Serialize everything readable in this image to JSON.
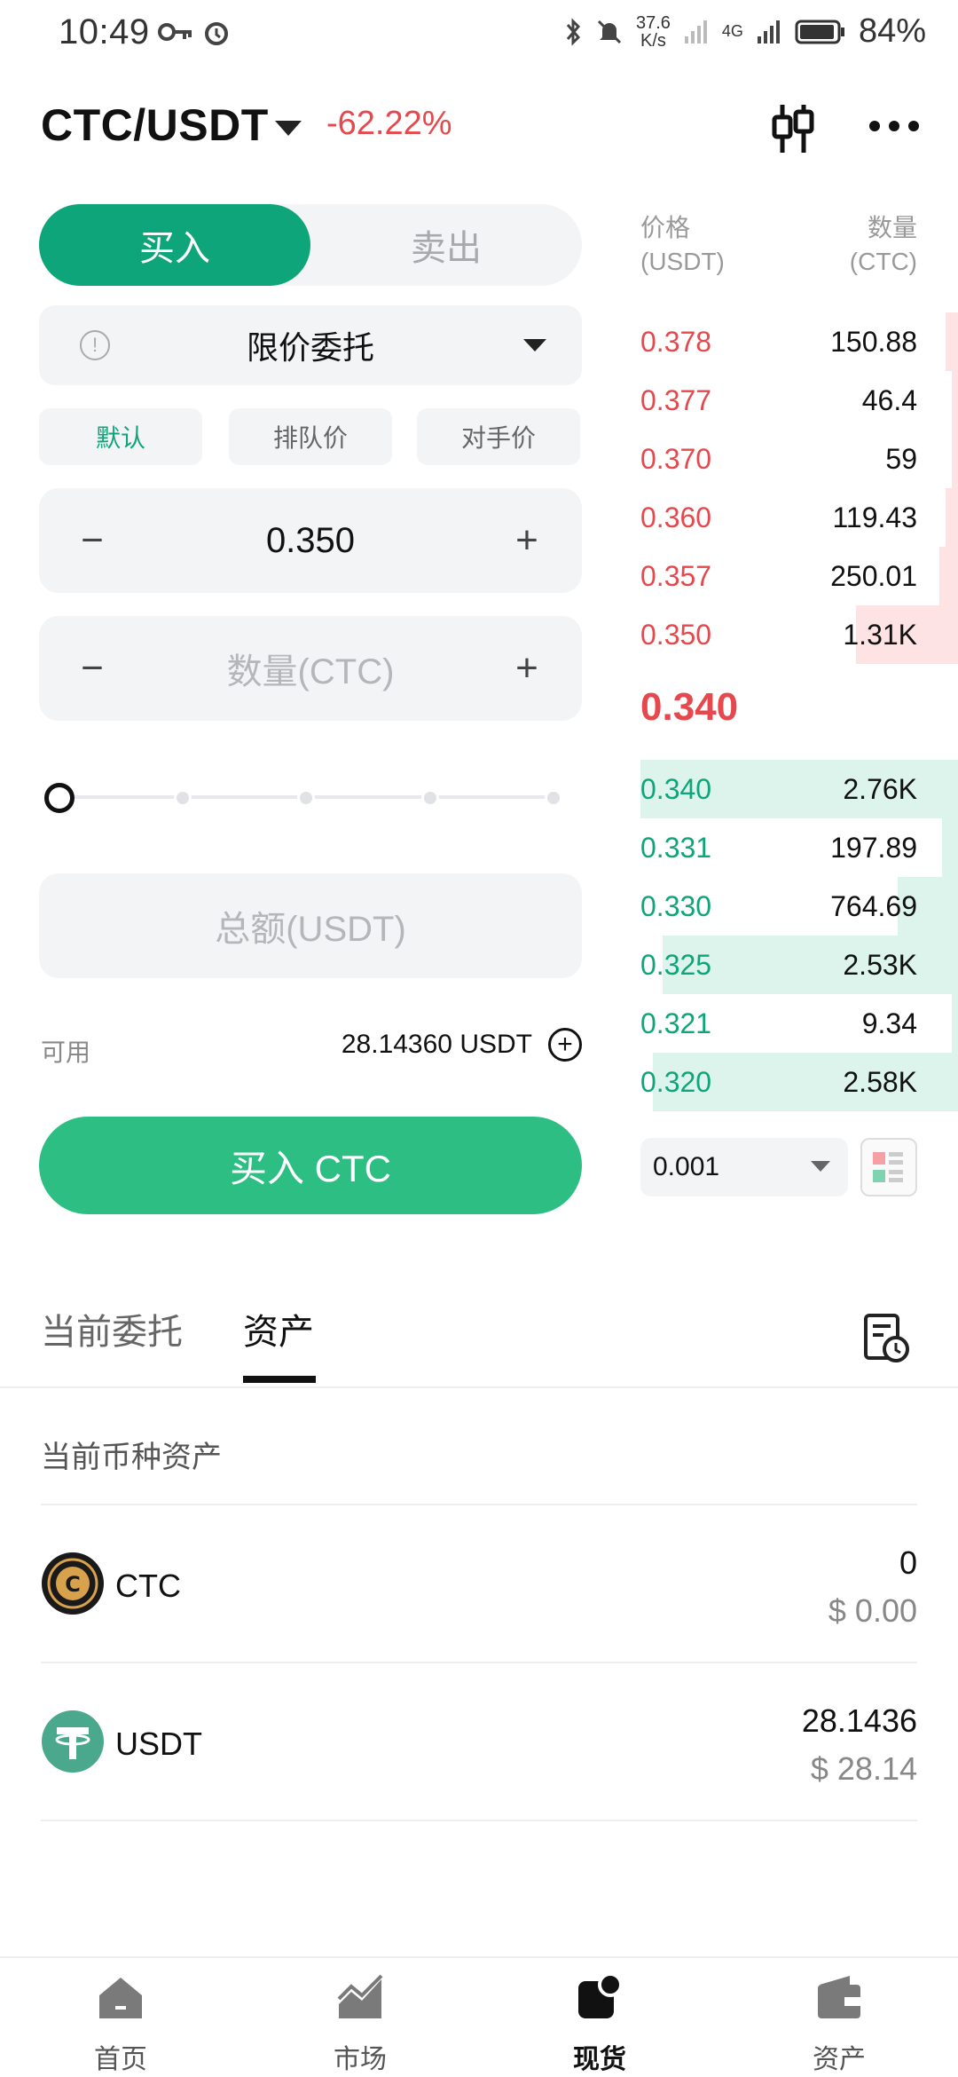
{
  "status_bar": {
    "time": "10:49",
    "speed_top": "37.6",
    "speed_bottom": "K/s",
    "network": "4G",
    "battery": "84%"
  },
  "header": {
    "pair": "CTC/USDT",
    "change": "-62.22%"
  },
  "trade": {
    "buy_tab": "买入",
    "sell_tab": "卖出",
    "order_type": "限价委托",
    "chips": [
      "默认",
      "排队价",
      "对手价"
    ],
    "price_value": "0.350",
    "amount_placeholder": "数量(CTC)",
    "slider_level": 0,
    "total_placeholder": "总额(USDT)",
    "available_label": "可用",
    "available_value": "28.14360 USDT",
    "buy_button": "买入 CTC"
  },
  "order_book": {
    "header_price": "价格",
    "header_price_unit": "(USDT)",
    "header_qty": "数量",
    "header_qty_unit": "(CTC)",
    "asks": [
      {
        "price": "0.378",
        "qty": "150.88",
        "depth": 0.04
      },
      {
        "price": "0.377",
        "qty": "46.4",
        "depth": 0.02
      },
      {
        "price": "0.370",
        "qty": "59",
        "depth": 0.02
      },
      {
        "price": "0.360",
        "qty": "119.43",
        "depth": 0.04
      },
      {
        "price": "0.357",
        "qty": "250.01",
        "depth": 0.06
      },
      {
        "price": "0.350",
        "qty": "1.31K",
        "depth": 0.32
      }
    ],
    "last_price": "0.340",
    "bids": [
      {
        "price": "0.340",
        "qty": "2.76K",
        "depth": 1.0
      },
      {
        "price": "0.331",
        "qty": "197.89",
        "depth": 0.05
      },
      {
        "price": "0.330",
        "qty": "764.69",
        "depth": 0.19
      },
      {
        "price": "0.325",
        "qty": "2.53K",
        "depth": 0.93
      },
      {
        "price": "0.321",
        "qty": "9.34",
        "depth": 0.02
      },
      {
        "price": "0.320",
        "qty": "2.58K",
        "depth": 0.96
      }
    ],
    "precision": "0.001"
  },
  "bottom": {
    "tab_orders": "当前委托",
    "tab_assets": "资产",
    "section_title": "当前币种资产",
    "assets": [
      {
        "name": "CTC",
        "amount": "0",
        "usd": "$ 0.00"
      },
      {
        "name": "USDT",
        "amount": "28.1436",
        "usd": "$ 28.14"
      }
    ]
  },
  "nav": {
    "items": [
      "首页",
      "市场",
      "现货",
      "资产"
    ],
    "active": "现货"
  },
  "colors": {
    "green": "#0fa57a",
    "button_green": "#2dbe84",
    "red": "#e5484d"
  }
}
